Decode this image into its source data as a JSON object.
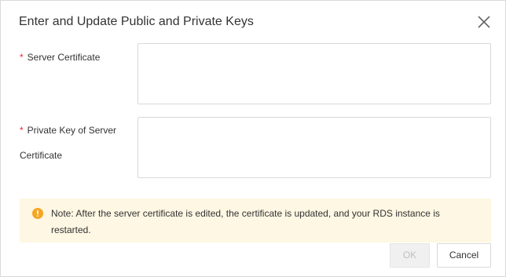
{
  "dialog": {
    "title": "Enter and Update Public and Private Keys",
    "close_icon": "close-icon"
  },
  "form": {
    "required_mark": "*",
    "server_certificate_label": "Server Certificate",
    "server_certificate_value": "",
    "private_key_label_line1": "Private Key of Server",
    "private_key_label_line2": "Certificate",
    "private_key_value": ""
  },
  "notice": {
    "icon": "warning-icon",
    "text": "Note: After the server certificate is edited, the certificate is updated, and your RDS instance is restarted."
  },
  "footer": {
    "ok_label": "OK",
    "ok_disabled": true,
    "cancel_label": "Cancel"
  },
  "colors": {
    "warning": "#f5a623",
    "notice_background": "#fdf7e3",
    "required": "#f5222d"
  }
}
